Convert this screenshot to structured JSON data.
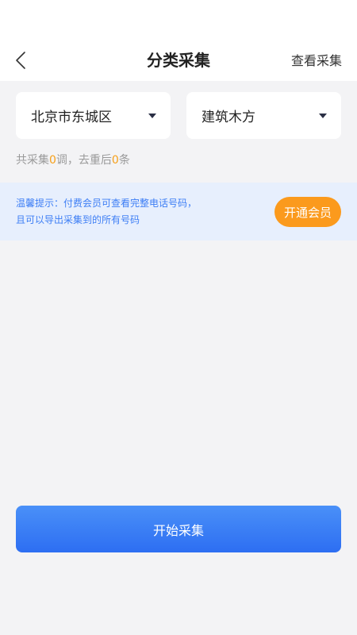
{
  "header": {
    "title": "分类采集",
    "view_link": "查看采集"
  },
  "filters": {
    "region": "北京市东城区",
    "category": "建筑木方"
  },
  "summary": {
    "prefix": "共采集",
    "count": "0",
    "middle": "调，去重后",
    "dedup_count": "0",
    "suffix": "条"
  },
  "tip": {
    "line1": "温馨提示：付费会员可查看完整电话号码，",
    "line2": "且可以导出采集到的所有号码",
    "button": "开通会员"
  },
  "actions": {
    "start": "开始采集"
  },
  "colors": {
    "accent": "#2d6ef2",
    "highlight": "#f6a01a",
    "vip": "#fb9a1d"
  }
}
